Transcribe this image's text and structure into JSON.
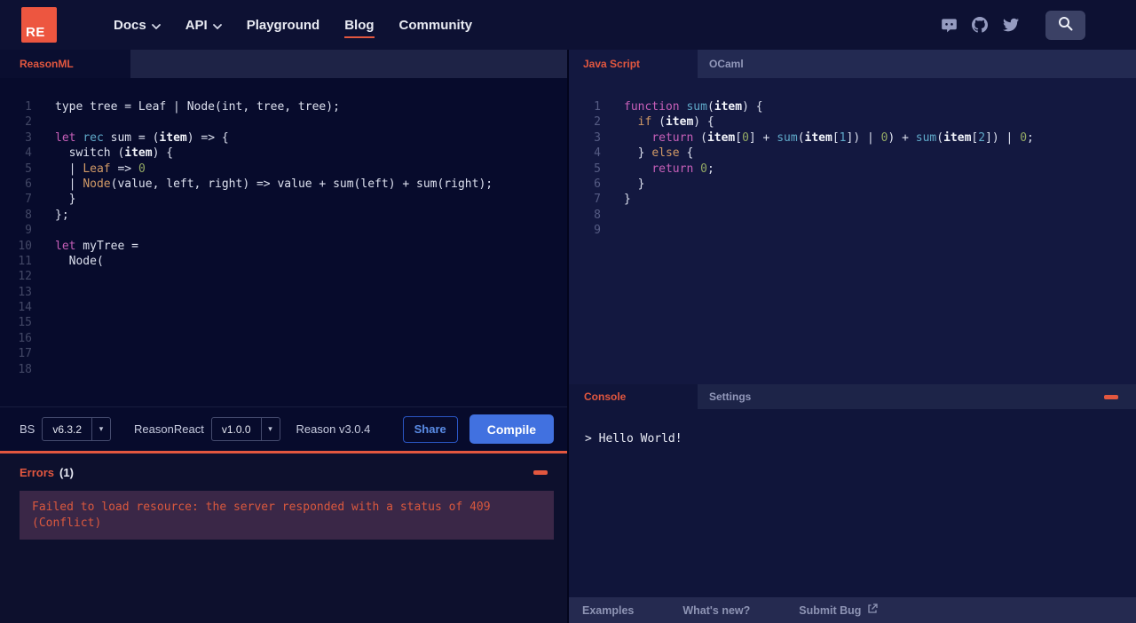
{
  "colors": {
    "accent": "#e2573f",
    "logo": "#ed5640",
    "nav_bg": "#0d1133",
    "nav_link": "#e8eaf2",
    "tabbar_bg": "#1e2346",
    "active_tab_bg": "#0a0e30",
    "left_editor_bg": "#070b2c",
    "right_editor_bg": "#131840",
    "console_header_bg": "#1d2448",
    "console_bg": "#10153a",
    "footer_bg": "#252a50",
    "footer_link": "#8e94b4",
    "errors_bg": "#0d102d",
    "error_box_bg": "#3a2747",
    "error_text": "#d9583e",
    "compile_bg": "#4171e0",
    "share_text": "#5a8ce6",
    "share_border": "#2a56c4",
    "toolbar_text": "#c8cce0",
    "muted": "#9298ba",
    "ln_left": "#434866",
    "ln_right": "#565c84",
    "code_plain": "#dce0ee",
    "code_bold": "#f2f4fa",
    "code_pink": "#c75fb8",
    "code_orange": "#d19a66",
    "code_green": "#93a964",
    "code_cyan": "#5fa9c9"
  },
  "nav": {
    "logo_text": "RE",
    "items": [
      {
        "label": "Docs",
        "chevron": true,
        "active": false
      },
      {
        "label": "API",
        "chevron": true,
        "active": false
      },
      {
        "label": "Playground",
        "chevron": false,
        "active": false
      },
      {
        "label": "Blog",
        "chevron": false,
        "active": true
      },
      {
        "label": "Community",
        "chevron": false,
        "active": false
      }
    ],
    "social_icons": [
      "discord-icon",
      "github-icon",
      "twitter-icon"
    ]
  },
  "reason_pane": {
    "tab_label": "ReasonML",
    "code_lines": [
      {
        "n": "1",
        "tokens": [
          [
            "p",
            "type tree = Leaf | Node(int, tree, tree);"
          ]
        ]
      },
      {
        "n": "2",
        "tokens": []
      },
      {
        "n": "3",
        "tokens": [
          [
            "pink",
            "let"
          ],
          [
            "p",
            " "
          ],
          [
            "cyan",
            "rec"
          ],
          [
            "p",
            " sum = ("
          ],
          [
            "b",
            "item"
          ],
          [
            "p",
            ") => {"
          ]
        ]
      },
      {
        "n": "4",
        "tokens": [
          [
            "p",
            "  switch ("
          ],
          [
            "b",
            "item"
          ],
          [
            "p",
            ") {"
          ]
        ]
      },
      {
        "n": "5",
        "tokens": [
          [
            "p",
            "  | "
          ],
          [
            "orange",
            "Leaf"
          ],
          [
            "p",
            " => "
          ],
          [
            "green",
            "0"
          ]
        ]
      },
      {
        "n": "6",
        "tokens": [
          [
            "p",
            "  | "
          ],
          [
            "orange",
            "Node"
          ],
          [
            "p",
            "(value, left, right) => value + sum(left) + sum(right);"
          ]
        ]
      },
      {
        "n": "7",
        "tokens": [
          [
            "p",
            "  }"
          ]
        ]
      },
      {
        "n": "8",
        "tokens": [
          [
            "p",
            "};"
          ]
        ]
      },
      {
        "n": "9",
        "tokens": []
      },
      {
        "n": "10",
        "tokens": [
          [
            "pink",
            "let"
          ],
          [
            "p",
            " myTree ="
          ]
        ]
      },
      {
        "n": "11",
        "tokens": [
          [
            "p",
            "  Node("
          ]
        ]
      },
      {
        "n": "12",
        "tokens": []
      },
      {
        "n": "13",
        "tokens": []
      },
      {
        "n": "14",
        "tokens": []
      },
      {
        "n": "15",
        "tokens": []
      },
      {
        "n": "16",
        "tokens": []
      },
      {
        "n": "17",
        "tokens": []
      },
      {
        "n": "18",
        "tokens": []
      }
    ]
  },
  "js_pane": {
    "tabs": [
      {
        "label": "Java Script",
        "active": true
      },
      {
        "label": "OCaml",
        "active": false
      }
    ],
    "code_lines": [
      {
        "n": "1",
        "tokens": [
          [
            "pink",
            "function"
          ],
          [
            "p",
            " "
          ],
          [
            "cyan",
            "sum"
          ],
          [
            "p",
            "("
          ],
          [
            "b",
            "item"
          ],
          [
            "p",
            ") {"
          ]
        ]
      },
      {
        "n": "2",
        "tokens": [
          [
            "p",
            "  "
          ],
          [
            "orange",
            "if"
          ],
          [
            "p",
            " ("
          ],
          [
            "b",
            "item"
          ],
          [
            "p",
            ") {"
          ]
        ]
      },
      {
        "n": "3",
        "tokens": [
          [
            "p",
            "    "
          ],
          [
            "pink",
            "return"
          ],
          [
            "p",
            " ("
          ],
          [
            "b",
            "item"
          ],
          [
            "p",
            "["
          ],
          [
            "green",
            "0"
          ],
          [
            "p",
            "] + "
          ],
          [
            "cyan",
            "sum"
          ],
          [
            "p",
            "("
          ],
          [
            "b",
            "item"
          ],
          [
            "p",
            "["
          ],
          [
            "cyan",
            "1"
          ],
          [
            "p",
            "]) | "
          ],
          [
            "green",
            "0"
          ],
          [
            "p",
            ") + "
          ],
          [
            "cyan",
            "sum"
          ],
          [
            "p",
            "("
          ],
          [
            "b",
            "item"
          ],
          [
            "p",
            "["
          ],
          [
            "cyan",
            "2"
          ],
          [
            "p",
            "]) | "
          ],
          [
            "green",
            "0"
          ],
          [
            "p",
            ";"
          ]
        ]
      },
      {
        "n": "4",
        "tokens": [
          [
            "p",
            "  } "
          ],
          [
            "orange",
            "else"
          ],
          [
            "p",
            " {"
          ]
        ]
      },
      {
        "n": "5",
        "tokens": [
          [
            "p",
            "    "
          ],
          [
            "pink",
            "return"
          ],
          [
            "p",
            " "
          ],
          [
            "green",
            "0"
          ],
          [
            "p",
            ";"
          ]
        ]
      },
      {
        "n": "6",
        "tokens": [
          [
            "p",
            "  }"
          ]
        ]
      },
      {
        "n": "7",
        "tokens": [
          [
            "p",
            "}"
          ]
        ]
      },
      {
        "n": "8",
        "tokens": []
      },
      {
        "n": "9",
        "tokens": []
      }
    ]
  },
  "toolbar": {
    "bs_label": "BS",
    "bs_version": "v6.3.2",
    "reasonreact_label": "ReasonReact",
    "reasonreact_version": "v1.0.0",
    "reason_version": "Reason v3.0.4",
    "share_label": "Share",
    "compile_label": "Compile"
  },
  "errors_panel": {
    "title": "Errors",
    "count": "(1)",
    "message": "Failed to load resource: the server responded with a status of 409 (Conflict)"
  },
  "console_panel": {
    "tabs": [
      {
        "label": "Console",
        "active": true
      },
      {
        "label": "Settings",
        "active": false
      }
    ],
    "output": "> Hello World!"
  },
  "footer": {
    "links": [
      {
        "label": "Examples"
      },
      {
        "label": "What's new?"
      },
      {
        "label": "Submit Bug",
        "icon": "external-link-icon"
      }
    ]
  }
}
